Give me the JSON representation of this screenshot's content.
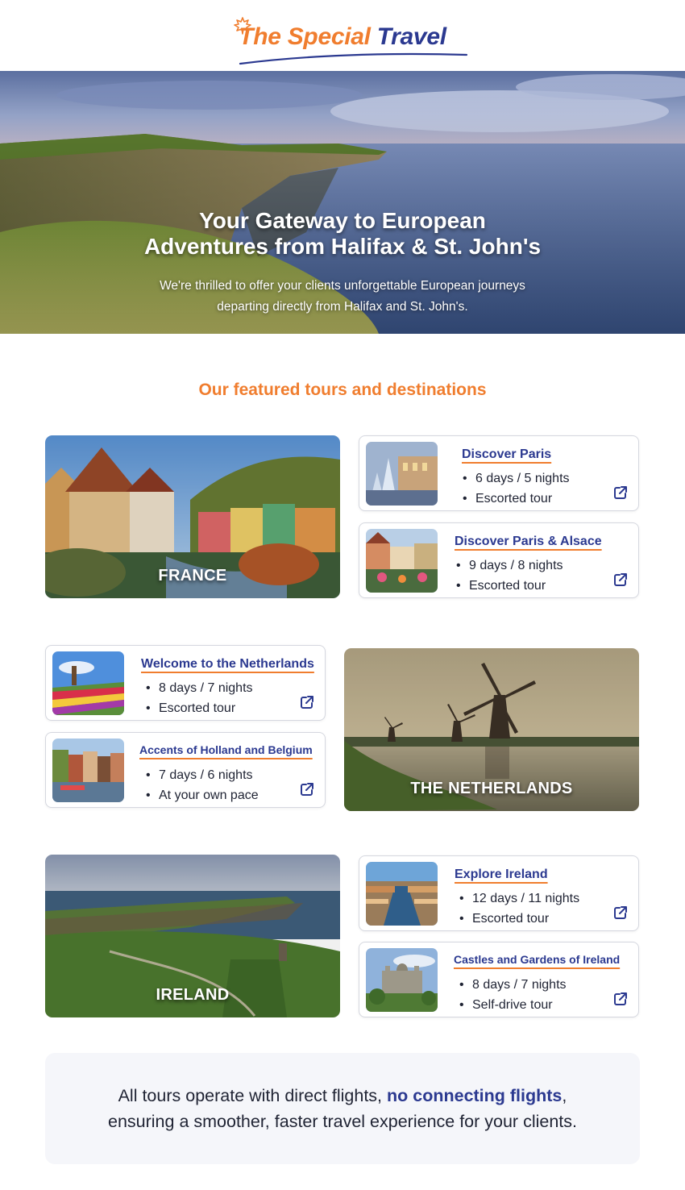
{
  "brand": {
    "word1": "The Special",
    "word2": "Travel",
    "orange": "#f07d2e",
    "navy": "#2b3990"
  },
  "hero": {
    "title_line1": "Your Gateway to European",
    "title_line2": "Adventures from Halifax & St. John's",
    "subtitle_line1": "We're thrilled to offer your clients unforgettable European journeys",
    "subtitle_line2": "departing directly from Halifax and St. John's."
  },
  "section_heading": "Our featured tours and destinations",
  "destinations": {
    "france": {
      "label": "FRANCE"
    },
    "netherlands": {
      "label": "THE NETHERLANDS"
    },
    "ireland": {
      "label": "IRELAND"
    }
  },
  "tours": [
    {
      "title": "Discover Paris",
      "duration": "6 days / 5 nights",
      "type": "Escorted tour",
      "icon": "external-link-icon"
    },
    {
      "title": "Discover Paris & Alsace",
      "duration": "9 days / 8 nights",
      "type": "Escorted tour",
      "icon": "external-link-icon"
    },
    {
      "title": "Welcome to the Netherlands",
      "duration": "8 days / 7 nights",
      "type": "Escorted tour",
      "icon": "external-link-icon"
    },
    {
      "title": "Accents of Holland and Belgium",
      "duration": "7 days / 6 nights",
      "type": "At your own pace",
      "icon": "external-link-icon"
    },
    {
      "title": "Explore Ireland",
      "duration": "12 days / 11 nights",
      "type": "Escorted tour",
      "icon": "external-link-icon"
    },
    {
      "title": "Castles and Gardens of Ireland",
      "duration": "8 days / 7 nights",
      "type": "Self-drive tour",
      "icon": "external-link-icon"
    }
  ],
  "note": {
    "before": "All tours operate with direct flights,",
    "highlight": "no connecting flights",
    "after": ",",
    "line2": "ensuring a smoother, faster travel experience for your clients."
  }
}
